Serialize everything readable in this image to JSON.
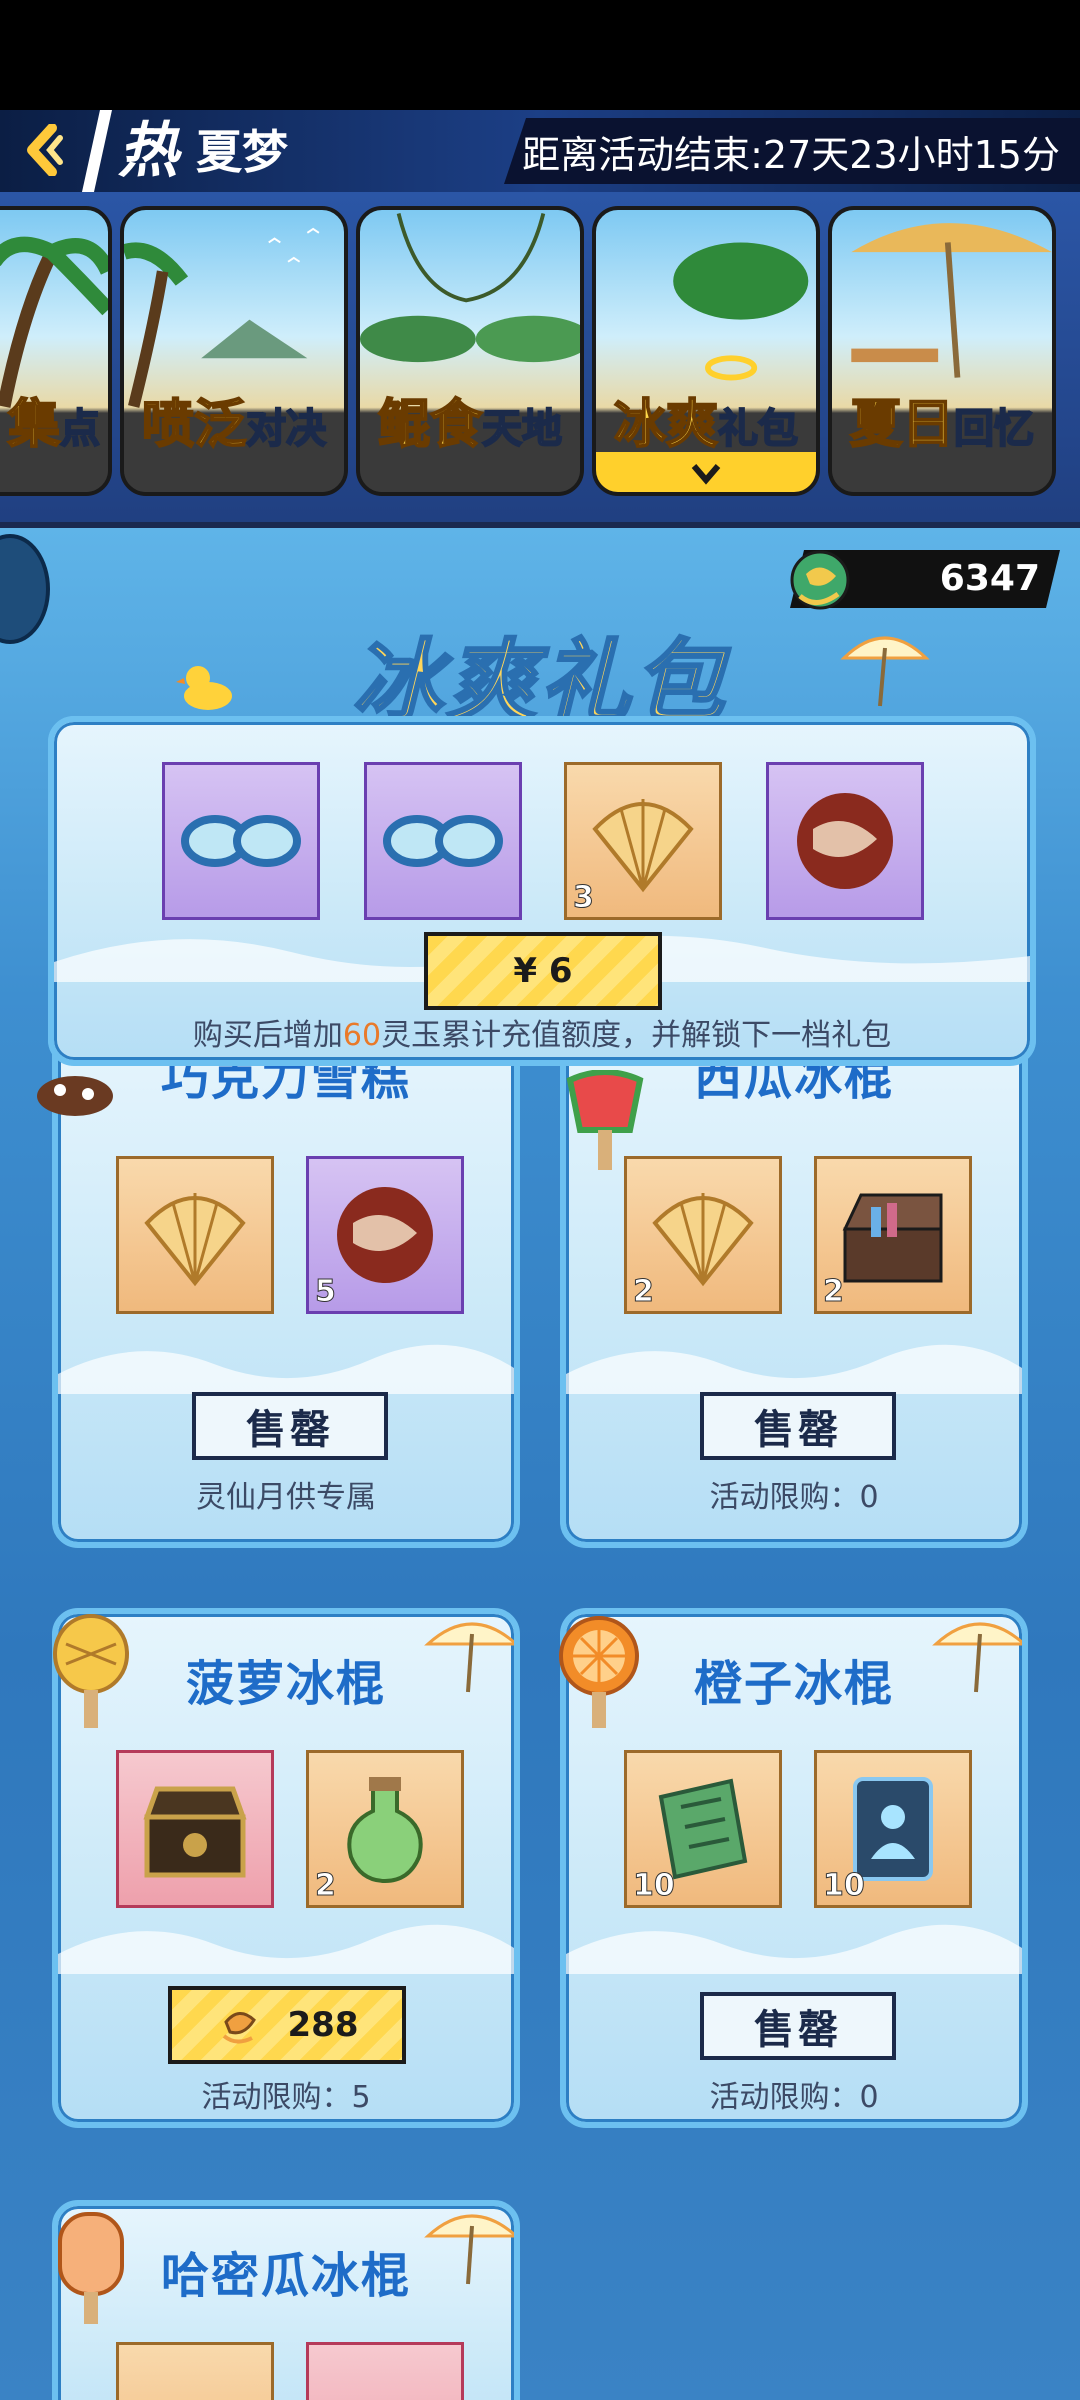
{
  "header": {
    "hot_glyph": "热",
    "title": "夏梦",
    "countdown": "距离活动结束:27天23小时15分"
  },
  "tabs": [
    {
      "big": "集",
      "small": "点",
      "active": false
    },
    {
      "big": "喷泛",
      "small": "对决",
      "active": false
    },
    {
      "big": "鲲食",
      "small": "天地",
      "active": false
    },
    {
      "big": "冰爽",
      "small": "礼包",
      "active": true
    },
    {
      "big": "夏日",
      "small": "回忆",
      "active": false
    }
  ],
  "currency": {
    "icon": "koi-fish-icon",
    "value": "6347"
  },
  "banner_title": "冰爽礼包",
  "top_pack": {
    "items": [
      {
        "icon": "goggles-icon",
        "count": ""
      },
      {
        "icon": "goggles-icon",
        "count": ""
      },
      {
        "icon": "shell-icon",
        "count": "3"
      },
      {
        "icon": "pearl-orb-icon",
        "count": ""
      }
    ],
    "price": "¥ 6",
    "note_prefix": "购买后增加",
    "note_highlight": "60",
    "note_suffix": "灵玉累计充值额度，并解锁下一档礼包"
  },
  "cards": [
    {
      "title": "巧克力雪糕",
      "items": [
        {
          "icon": "shell-icon",
          "count": ""
        },
        {
          "icon": "pearl-orb-icon",
          "count": "5"
        }
      ],
      "button": "售罄",
      "footer": "灵仙月供专属"
    },
    {
      "title": "西瓜冰棍",
      "items": [
        {
          "icon": "shell-icon",
          "count": "2"
        },
        {
          "icon": "treasure-chest-icon",
          "count": "2"
        }
      ],
      "button": "售罄",
      "footer": "活动限购：0"
    },
    {
      "title": "菠萝冰棍",
      "items": [
        {
          "icon": "golden-chest-icon",
          "count": ""
        },
        {
          "icon": "potion-bottle-icon",
          "count": "2"
        }
      ],
      "button": "288",
      "footer": "活动限购：5"
    },
    {
      "title": "橙子冰棍",
      "items": [
        {
          "icon": "green-talisman-icon",
          "count": "10"
        },
        {
          "icon": "spirit-card-icon",
          "count": "10"
        }
      ],
      "button": "售罄",
      "footer": "活动限购：0"
    },
    {
      "title": "哈密瓜冰棍"
    }
  ]
}
